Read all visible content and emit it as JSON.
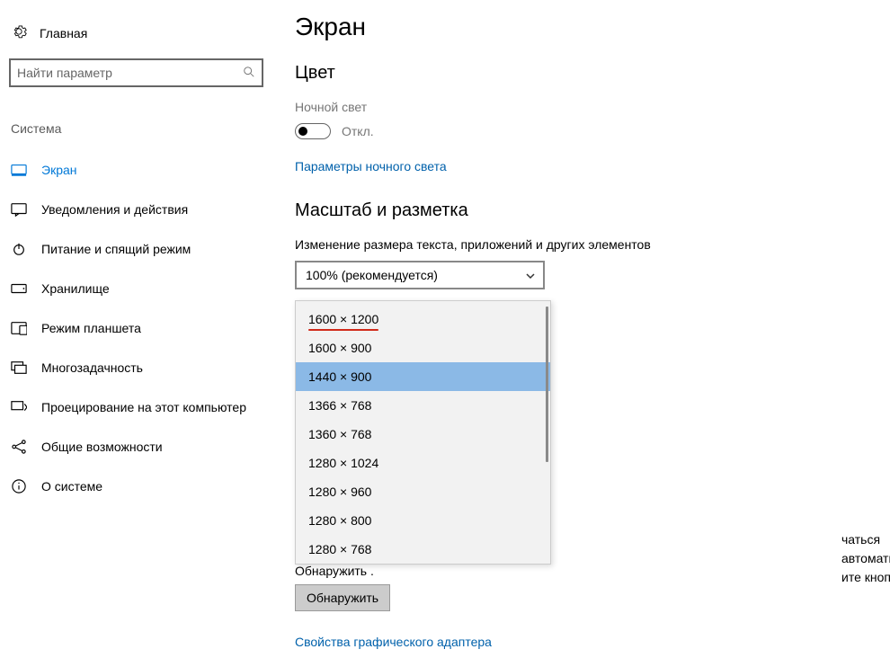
{
  "sidebar": {
    "home": "Главная",
    "search_placeholder": "Найти параметр",
    "section": "Система",
    "items": [
      {
        "label": "Экран",
        "icon": "display",
        "active": true
      },
      {
        "label": "Уведомления и действия",
        "icon": "notifications"
      },
      {
        "label": "Питание и спящий режим",
        "icon": "power"
      },
      {
        "label": "Хранилище",
        "icon": "storage"
      },
      {
        "label": "Режим планшета",
        "icon": "tablet"
      },
      {
        "label": "Многозадачность",
        "icon": "multitask"
      },
      {
        "label": "Проецирование на этот компьютер",
        "icon": "project"
      },
      {
        "label": "Общие возможности",
        "icon": "shared"
      },
      {
        "label": "О системе",
        "icon": "about"
      }
    ]
  },
  "main": {
    "title": "Экран",
    "color_section": "Цвет",
    "night_light_label": "Ночной свет",
    "toggle_state": "Откл.",
    "night_light_link": "Параметры ночного света",
    "scale_section": "Масштаб и разметка",
    "scale_label": "Изменение размера текста, приложений и других элементов",
    "scale_value": "100% (рекомендуется)",
    "resolutions": [
      "1600 × 1200",
      "1600 × 900",
      "1440 × 900",
      "1366 × 768",
      "1360 × 768",
      "1280 × 1024",
      "1280 × 960",
      "1280 × 800",
      "1280 × 768"
    ],
    "resolution_selected_index": 2,
    "resolution_highlighted_index": 0,
    "behind_text_1": "чаться автоматически.",
    "behind_text_2": "ите кнопку",
    "behind_text_3": "Обнаружить .",
    "detect_button": "Обнаружить",
    "adapter_link": "Свойства графического адаптера"
  }
}
